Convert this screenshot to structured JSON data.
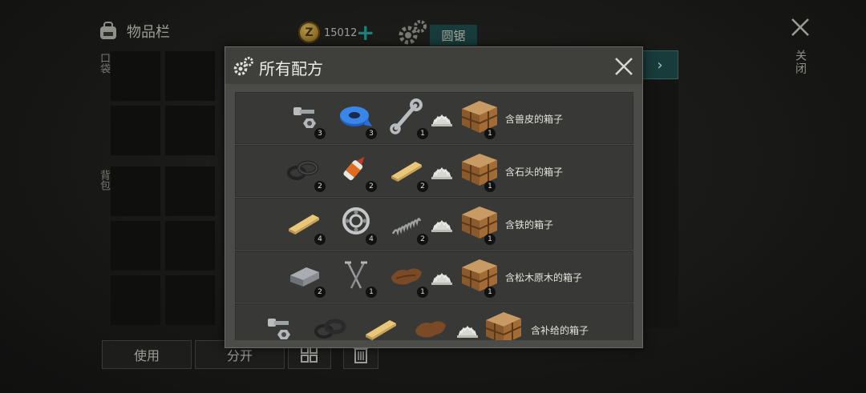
{
  "inventory": {
    "title": "物品栏",
    "hands_label": "口袋",
    "backpack_label": "背包",
    "use_label": "使用",
    "split_label": "分开"
  },
  "currency": {
    "amount": "15012",
    "symbol": "Z"
  },
  "workbench": {
    "tab_label": "圆锯"
  },
  "close_label": "关闭",
  "modal": {
    "title": "所有配方"
  },
  "recipes": [
    {
      "result": "含兽皮的箱子",
      "ingredients": [
        {
          "icon": "bolt-nut-icon",
          "count": "3"
        },
        {
          "icon": "blue-tape-icon",
          "count": "3"
        },
        {
          "icon": "wrench-icon",
          "count": "1"
        }
      ],
      "result_count": "1"
    },
    {
      "result": "含石头的箱子",
      "ingredients": [
        {
          "icon": "rubber-rings-icon",
          "count": "2"
        },
        {
          "icon": "glue-icon",
          "count": "2"
        },
        {
          "icon": "plank-icon",
          "count": "2"
        }
      ],
      "result_count": "1"
    },
    {
      "result": "含铁的箱子",
      "ingredients": [
        {
          "icon": "plank-icon",
          "count": "4"
        },
        {
          "icon": "bearing-icon",
          "count": "4"
        },
        {
          "icon": "spring-icon",
          "count": "2"
        }
      ],
      "result_count": "1"
    },
    {
      "result": "含松木原木的箱子",
      "ingredients": [
        {
          "icon": "iron-ingot-icon",
          "count": "2"
        },
        {
          "icon": "nails-icon",
          "count": "1"
        },
        {
          "icon": "leather-icon",
          "count": "1"
        }
      ],
      "result_count": "1"
    },
    {
      "result": "含补给的箱子",
      "ingredients": [
        {
          "icon": "bolt-nut-icon",
          "count": ""
        },
        {
          "icon": "rubber-rings-icon",
          "count": ""
        },
        {
          "icon": "plank-icon",
          "count": ""
        },
        {
          "icon": "leather-icon",
          "count": ""
        }
      ],
      "result_count": ""
    }
  ],
  "colors": {
    "accent": "#1f4e4c",
    "plus": "#2aa39a"
  }
}
